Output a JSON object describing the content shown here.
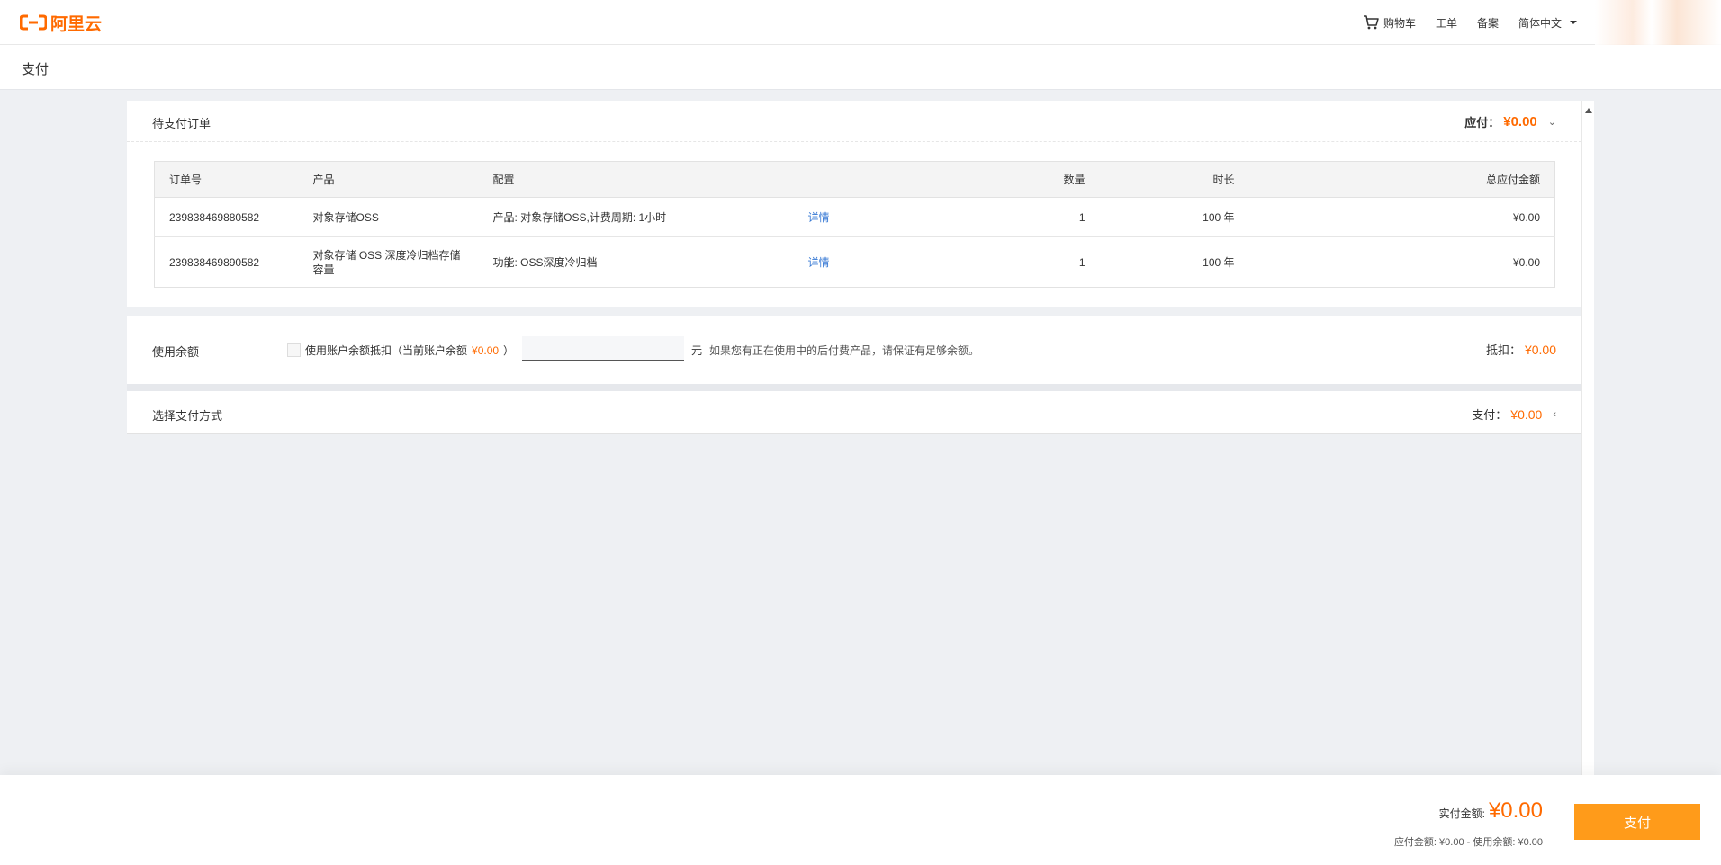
{
  "brand": {
    "logo_text": "阿里云",
    "accent": "#ff6a00"
  },
  "topnav": {
    "cart": "购物车",
    "ticket": "工单",
    "filing": "备案",
    "language": "简体中文"
  },
  "page": {
    "title": "支付"
  },
  "orders_panel": {
    "title": "待支付订单",
    "payable_label": "应付：",
    "payable_amount": "¥0.00",
    "columns": [
      "订单号",
      "产品",
      "配置",
      "",
      "数量",
      "时长",
      "总应付金额"
    ],
    "rows": [
      {
        "order_no": "239838469880582",
        "product": "对象存储OSS",
        "config": "产品: 对象存储OSS,计费周期: 1小时",
        "detail": "详情",
        "qty": "1",
        "duration": "100 年",
        "total": "¥0.00"
      },
      {
        "order_no": "239838469890582",
        "product": "对象存储 OSS 深度冷归档存储容量",
        "config": "功能: OSS深度冷归档",
        "detail": "详情",
        "qty": "1",
        "duration": "100 年",
        "total": "¥0.00"
      }
    ]
  },
  "balance_panel": {
    "label": "使用余额",
    "checkbox_label": "使用账户余额抵扣（当前账户余额",
    "current_balance": "¥0.00",
    "close_paren": "）",
    "input_value": "",
    "unit": "元",
    "hint": "如果您有正在使用中的后付费产品，请保证有足够余额。",
    "deduct_label": "抵扣：",
    "deduct_amount": "¥0.00"
  },
  "pay_method_panel": {
    "label": "选择支付方式",
    "pay_label": "支付：",
    "pay_amount": "¥0.00"
  },
  "footer": {
    "actual_label": "实付金额:",
    "actual_amount": "¥0.00",
    "breakdown": "应付金额: ¥0.00 - 使用余额: ¥0.00",
    "pay_button": "支付"
  }
}
